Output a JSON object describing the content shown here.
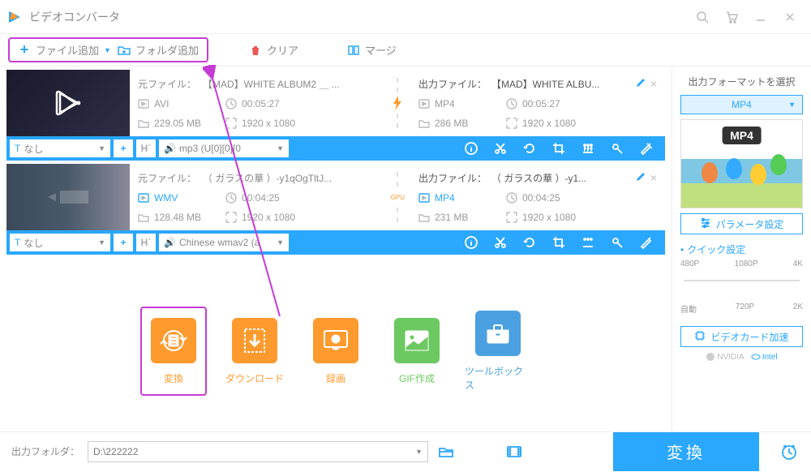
{
  "app": {
    "title": "ビデオコンバータ"
  },
  "toolbar": {
    "add_file": "ファイル追加",
    "add_folder": "フォルダ追加",
    "clear": "クリア",
    "merge": "マージ"
  },
  "items": [
    {
      "src_label": "元ファイル：",
      "src_name": "【MAD】WHITE ALBUM2 ＿ ...",
      "src_format": "AVI",
      "src_duration": "00:05:27",
      "src_size": "229.05 MB",
      "src_res": "1920 x 1080",
      "out_label": "出力ファイル：",
      "out_name": "【MAD】WHITE ALBU...",
      "out_format": "MP4",
      "out_duration": "00:05:27",
      "out_size": "286 MB",
      "out_res": "1920 x 1080",
      "sub_label": "なし",
      "audio_label": "mp3 (U[0][0][0"
    },
    {
      "src_label": "元ファイル：",
      "src_name": "（ ガラスの華 ）-y1qOgTltJ...",
      "src_format": "WMV",
      "src_duration": "00:04:25",
      "src_size": "128.48 MB",
      "src_res": "1920 x 1080",
      "out_label": "出力ファイル：",
      "out_name": "（ ガラスの華 ）-y1...",
      "out_format": "MP4",
      "out_duration": "00:04:25",
      "out_size": "231 MB",
      "out_res": "1920 x 1080",
      "sub_label": "なし",
      "audio_label": "Chinese wmav2 (a",
      "gpu_label": "GPU"
    }
  ],
  "cards": {
    "convert": "変換",
    "download": "ダウンロード",
    "record": "録画",
    "gif": "GIF作成",
    "toolbox": "ツールボックス"
  },
  "right": {
    "heading": "出力フォーマットを選択",
    "format": "MP4",
    "mp4_badge": "MP4",
    "param_btn": "パラメータ設定",
    "quick_title": "クイック設定",
    "presets_top": [
      "480P",
      "1080P",
      "4K"
    ],
    "presets_bottom": [
      "自動",
      "720P",
      "2K"
    ],
    "gpu_btn": "ビデオカード加速",
    "vendor_nvidia": "NVIDIA",
    "vendor_intel": "Intel"
  },
  "bottom": {
    "out_folder_label": "出力フォルダ：",
    "path": "D:\\222222",
    "convert": "変換"
  }
}
